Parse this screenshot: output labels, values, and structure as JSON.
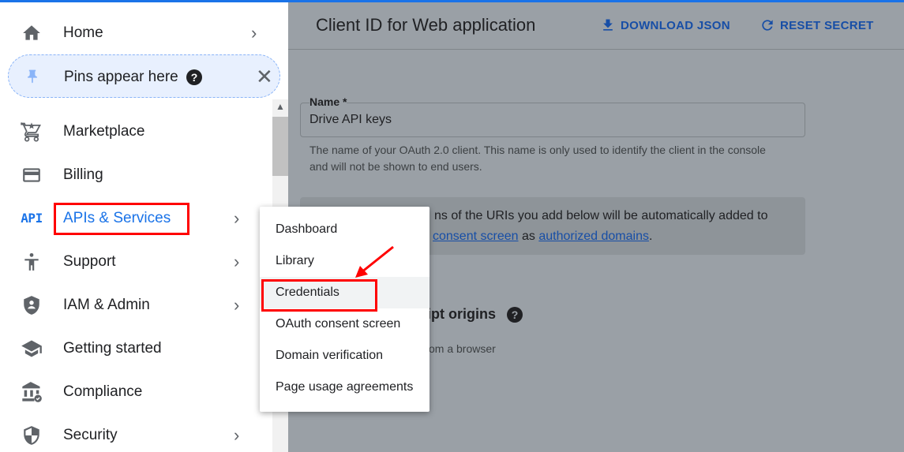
{
  "header": {
    "title": "Client ID for Web application",
    "download_label": "DOWNLOAD JSON",
    "reset_label": "RESET SECRET"
  },
  "form": {
    "name_label": "Name *",
    "name_value": "Drive API keys",
    "name_hint": "The name of your OAuth 2.0 client. This name is only used to identify the client in the console and will not be shown to end users.",
    "info_line1": "ns of the URIs you add below will be automatically added to",
    "info_link1": "consent screen",
    "info_mid": "as",
    "info_link2": "authorized domains",
    "info_end": ".",
    "section_title": "ipt origins",
    "section_sub": "om a browser"
  },
  "nav": {
    "home": "Home",
    "pins": "Pins appear here",
    "marketplace": "Marketplace",
    "billing": "Billing",
    "apis_icon_text": "API",
    "apis": "APIs & Services",
    "support": "Support",
    "iam": "IAM & Admin",
    "getting_started": "Getting started",
    "compliance": "Compliance",
    "security": "Security"
  },
  "submenu": {
    "items": [
      "Dashboard",
      "Library",
      "Credentials",
      "OAuth consent screen",
      "Domain verification",
      "Page usage agreements"
    ],
    "selected": "Credentials"
  },
  "colors": {
    "accent": "#1a73e8",
    "annotation": "#ff0000",
    "overlay": "#9aa0a6"
  }
}
